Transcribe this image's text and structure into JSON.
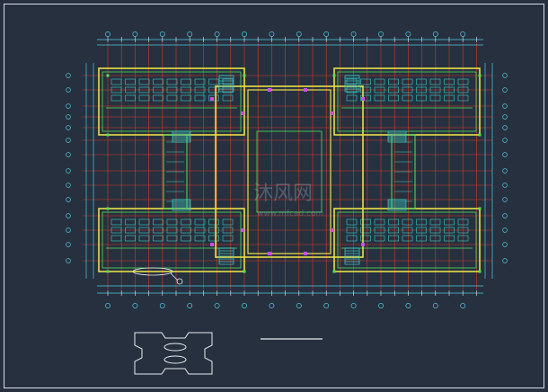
{
  "drawing": {
    "watermark_text": "沐风网",
    "watermark_url": "www.mfcad.com"
  },
  "colors": {
    "background": "#27303e",
    "frame": "#d8dde6",
    "axis_red": "#d23a2a",
    "wall_yellow": "#e8e04a",
    "wall_green": "#4fe35a",
    "dim_cyan": "#4fc9e6",
    "furniture_cyan": "#3ad0c8",
    "accent_magenta": "#c94fe6",
    "white": "#e8ecf2"
  },
  "icons": {
    "north_marker": "circle-marker-icon",
    "key_plan": "key-plan-outline-icon"
  }
}
